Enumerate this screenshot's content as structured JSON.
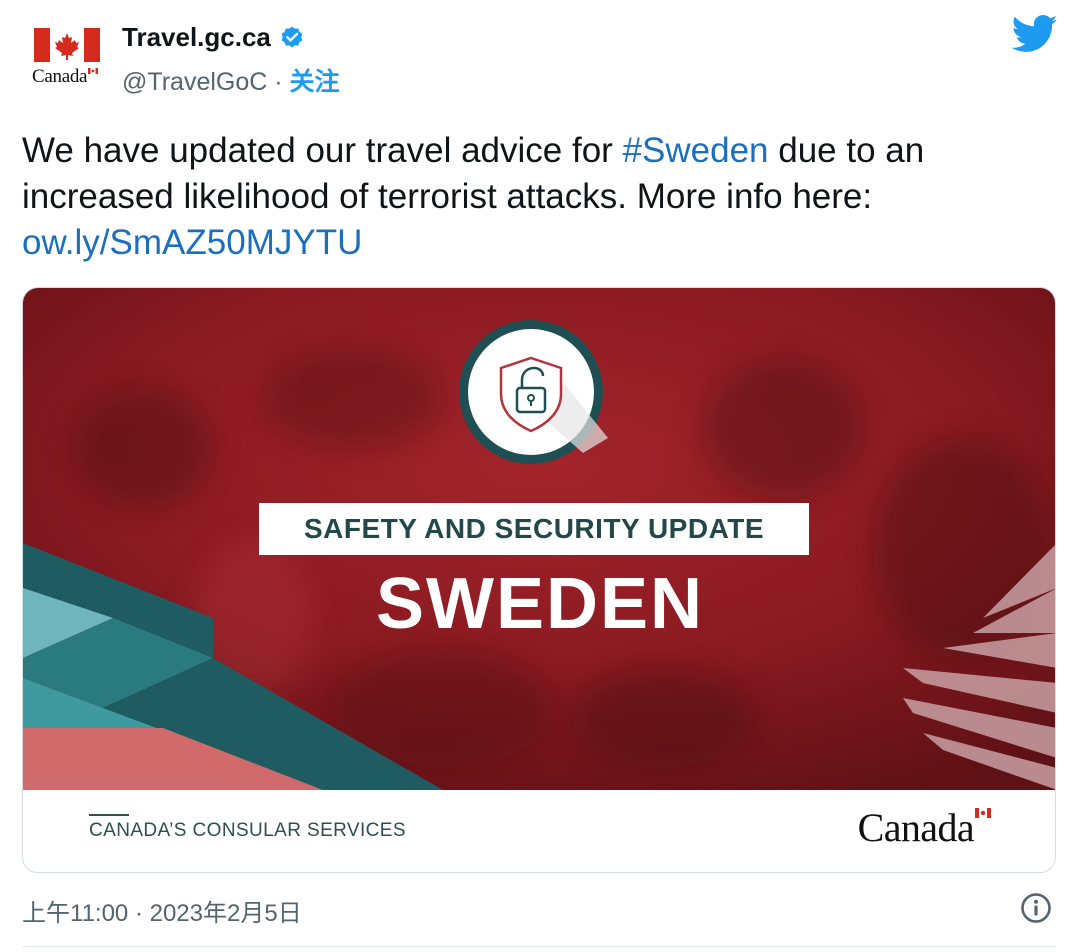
{
  "account": {
    "display_name": "Travel.gc.ca",
    "handle": "@TravelGoC",
    "separator": "·",
    "follow_label": "关注",
    "avatar_wordmark": "Canada"
  },
  "tweet": {
    "text_before": "We have updated our travel advice for ",
    "hashtag": "#Sweden",
    "text_after": " due to an increased likelihood of terrorist attacks. More info here: ",
    "link": "ow.ly/SmAZ50MJYTU"
  },
  "card": {
    "banner_label": "SAFETY AND SECURITY UPDATE",
    "country": "SWEDEN",
    "footer_left": "CANADA’S CONSULAR SERVICES",
    "footer_right": "Canada"
  },
  "meta": {
    "timestamp": "上午11:00 · 2023年2月5日"
  },
  "icons": {
    "verified": "verified-badge-icon",
    "brand": "twitter-bird-icon",
    "info": "info-icon",
    "shield": "shield-lock-icon"
  },
  "colors": {
    "link_blue": "#1b6fbf",
    "twitter_blue": "#1d9bf0",
    "banner_red": "#8e1a20",
    "teal": "#1f5d62",
    "canada_red": "#d52b1e"
  }
}
